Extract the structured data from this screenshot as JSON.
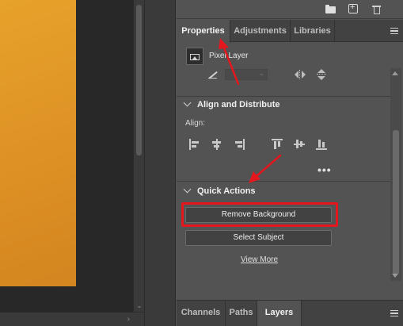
{
  "top_toolbar": {
    "icons": [
      "folder-icon",
      "new-layer-icon",
      "trash-icon"
    ]
  },
  "tabs": [
    {
      "label": "Properties",
      "active": true
    },
    {
      "label": "Adjustments",
      "active": false
    },
    {
      "label": "Libraries",
      "active": false
    }
  ],
  "layer": {
    "type_label": "Pixel Layer"
  },
  "align": {
    "title": "Align and Distribute",
    "label": "Align:",
    "more": "•••"
  },
  "quick_actions": {
    "title": "Quick Actions",
    "remove_bg_label": "Remove Background",
    "select_subject_label": "Select Subject",
    "view_more_label": "View More"
  },
  "bottom_tabs": [
    {
      "label": "Channels",
      "active": false
    },
    {
      "label": "Paths",
      "active": false
    },
    {
      "label": "Layers",
      "active": true
    }
  ],
  "colors": {
    "accent": "#e3181f",
    "canvas_orange": "#e09a26",
    "panel_bg": "#535353"
  }
}
